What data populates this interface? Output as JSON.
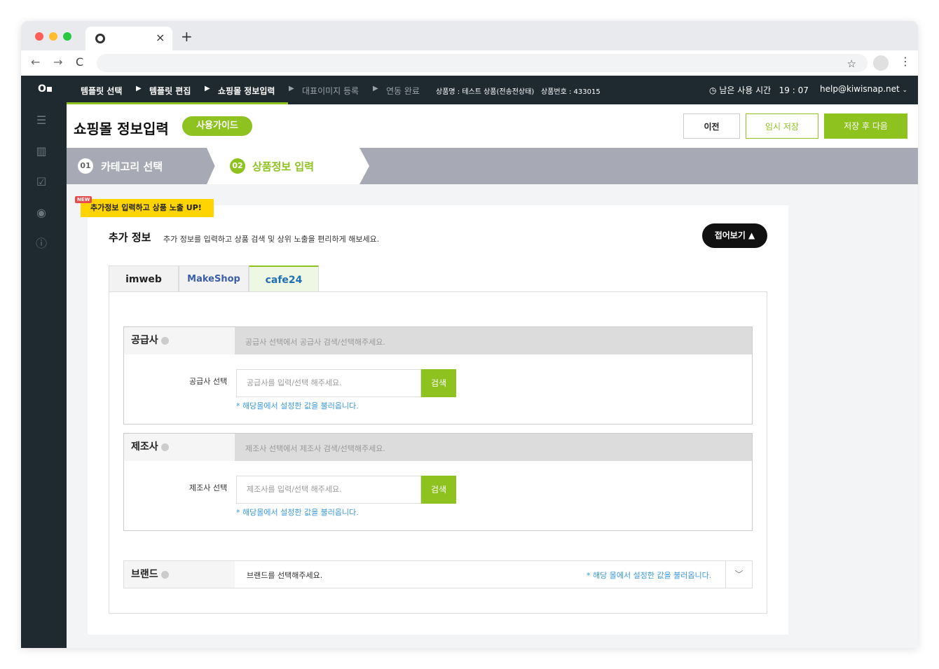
{
  "browser": {
    "tab_close": "×",
    "new_tab": "+",
    "nav_back": "←",
    "nav_forward": "→",
    "nav_reload": "C",
    "star": "☆",
    "kebab": "⋮"
  },
  "topnav": {
    "logo": "O▪",
    "steps": [
      "템플릿 선택",
      "템플릿 편집",
      "쇼핑몰 정보입력",
      "대표이미지 등록",
      "연동 완료"
    ],
    "product_name": "상품명 : 테스트 상품(전송전상태)",
    "product_number": "상품번호 : 433015",
    "time_label": "남은 사용 시간",
    "time_value": "19 : 07",
    "email": "help@kiwisnap.net"
  },
  "header": {
    "title": "쇼핑몰 정보입력",
    "guide": "사용가이드",
    "prev": "이전",
    "temp_save": "임시 저장",
    "save_next": "저장 후 다음"
  },
  "stepsbar": {
    "s1_num": "01",
    "s1_label": "카테고리 선택",
    "s2_num": "02",
    "s2_label": "상품정보 입력"
  },
  "content": {
    "new_badge": "NEW",
    "promo": "추가정보 입력하고 상품 노출 UP!",
    "section_title": "추가 정보",
    "section_desc": "추가 정보를 입력하고 상품 검색 및 상위 노출을 편리하게 해보세요.",
    "fold": "접어보기 ▲",
    "tabs": [
      "imweb",
      "MakeShop",
      "cafe24"
    ],
    "supplier": {
      "label": "공급사",
      "hint": "공급사 선택에서 공급사 검색/선택해주세요.",
      "sub_label": "공급사 선택",
      "placeholder": "공급사를 입력/선택 해주세요.",
      "search": "검색",
      "note": "* 해당몰에서 설정한 값을 불러옵니다."
    },
    "manufacturer": {
      "label": "제조사",
      "hint": "제조사 선택에서 제조사 검색/선택해주세요.",
      "sub_label": "제조사 선택",
      "placeholder": "제조사를 입력/선택 해주세요.",
      "search": "검색",
      "note": "* 해당몰에서 설정한 값을 불러옵니다."
    },
    "brand": {
      "label": "브랜드",
      "value": "브랜드를 선택해주세요.",
      "note": "* 해당 몰에서 설정한 값을 불러옵니다."
    }
  },
  "colors": {
    "accent": "#8dc21f",
    "nav_bg": "#1f2a30",
    "link": "#3b9ad9"
  }
}
